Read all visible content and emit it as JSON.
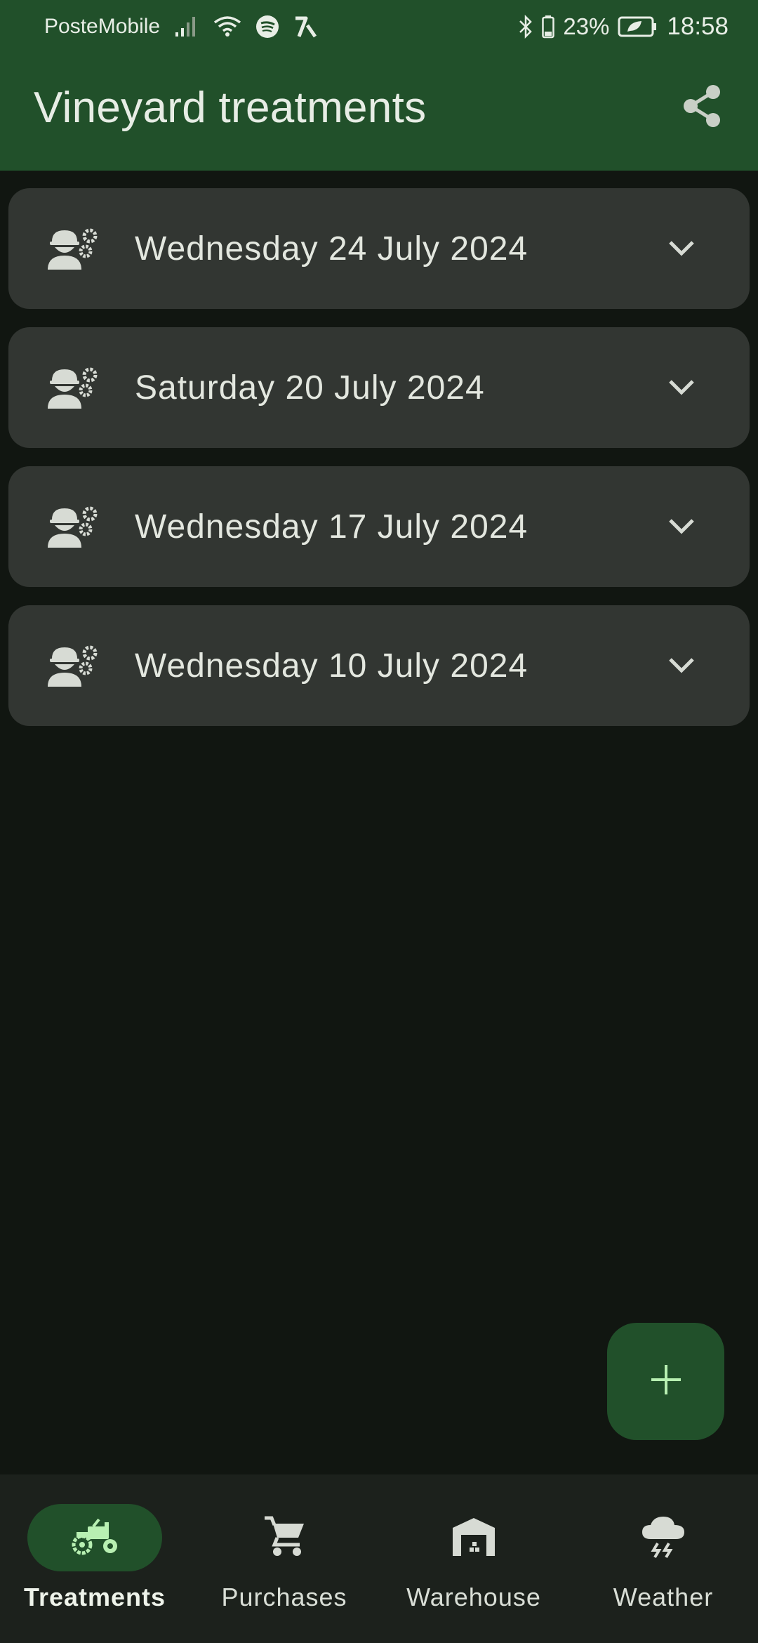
{
  "status_bar": {
    "carrier": "PosteMobile",
    "battery_percent": "23%",
    "time": "18:58",
    "icons": [
      "signal-icon",
      "wifi-icon",
      "spotify-icon",
      "app-notification-icon",
      "bluetooth-icon",
      "battery-icon",
      "power-saver-icon"
    ]
  },
  "app_bar": {
    "title": "Vineyard treatments",
    "share_icon": "share-icon"
  },
  "treatments": [
    {
      "date": "Wednesday 24 July 2024",
      "icon": "worker-settings-icon"
    },
    {
      "date": "Saturday 20 July 2024",
      "icon": "worker-settings-icon"
    },
    {
      "date": "Wednesday 17 July 2024",
      "icon": "worker-settings-icon"
    },
    {
      "date": "Wednesday 10 July 2024",
      "icon": "worker-settings-icon"
    }
  ],
  "fab": {
    "icon": "plus-icon"
  },
  "bottom_nav": {
    "items": [
      {
        "label": "Treatments",
        "icon": "tractor-icon",
        "active": true
      },
      {
        "label": "Purchases",
        "icon": "cart-icon",
        "active": false
      },
      {
        "label": "Warehouse",
        "icon": "warehouse-icon",
        "active": false
      },
      {
        "label": "Weather",
        "icon": "storm-cloud-icon",
        "active": false
      }
    ]
  },
  "colors": {
    "primary": "#21502a",
    "background": "#111611",
    "card": "#323632",
    "nav_background": "#1c211c",
    "on_surface": "#e3e7df",
    "fab_icon": "#b8f0b2"
  }
}
